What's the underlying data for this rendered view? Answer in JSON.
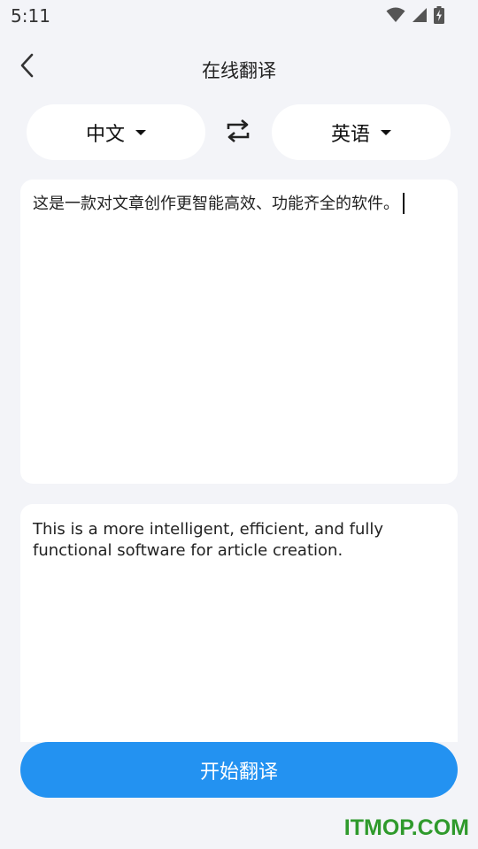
{
  "status_bar": {
    "time": "5:11",
    "icons": [
      "wifi-icon",
      "cellular-signal-icon",
      "battery-charging-icon"
    ]
  },
  "header": {
    "title": "在线翻译",
    "back_icon": "chevron-left-icon"
  },
  "language_bar": {
    "source_language": "中文",
    "target_language": "英语",
    "swap_icon": "swap-arrows-icon"
  },
  "input": {
    "value": "这是一款对文章创作更智能高效、功能齐全的软件。"
  },
  "output": {
    "value": "This is a more intelligent, efficient, and fully functional software for article creation."
  },
  "actions": {
    "translate_label": "开始翻译"
  },
  "watermark": "ITMOP.COM",
  "colors": {
    "background": "#f3f4f8",
    "accent": "#2392f1",
    "watermark": "#2f9a2c"
  }
}
